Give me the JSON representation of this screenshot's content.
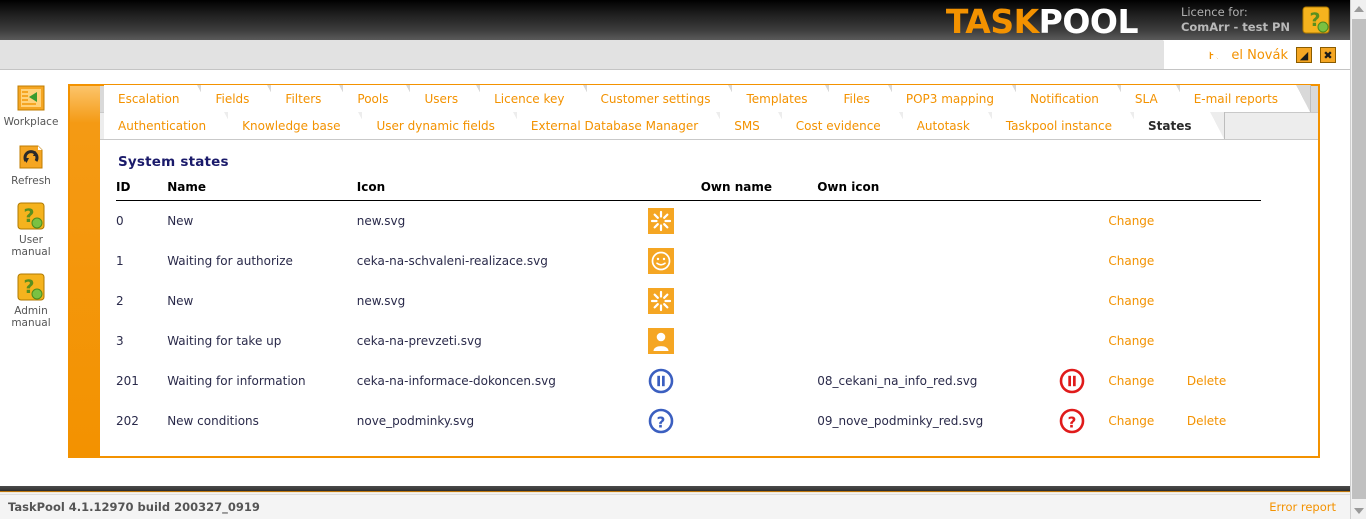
{
  "header": {
    "logo_task": "TASK",
    "logo_pool": "POOL",
    "licence_label": "Licence for:",
    "licence_value": "ComArr - test PN",
    "help_icon": "question-help-icon",
    "accent_color": "#f39200"
  },
  "userbar": {
    "username": "Pavel Novák",
    "logout_icon": "logout-arrow-icon",
    "close_icon": "close-x-icon",
    "logout_glyph": "◢",
    "close_glyph": "✖"
  },
  "sidebar": {
    "items": [
      {
        "label": "Workplace",
        "icon": "workplace-icon"
      },
      {
        "label": "Refresh",
        "icon": "refresh-icon"
      },
      {
        "label": "User\nmanual",
        "label_line1": "User",
        "label_line2": "manual",
        "icon": "user-manual-icon"
      },
      {
        "label": "Admin\nmanual",
        "label_line1": "Admin",
        "label_line2": "manual",
        "icon": "admin-manual-icon"
      }
    ]
  },
  "tabs_row1": [
    {
      "label": "Escalation",
      "active": false
    },
    {
      "label": "Fields",
      "active": false
    },
    {
      "label": "Filters",
      "active": false
    },
    {
      "label": "Pools",
      "active": false
    },
    {
      "label": "Users",
      "active": false
    },
    {
      "label": "Licence key",
      "active": false
    },
    {
      "label": "Customer settings",
      "active": false
    },
    {
      "label": "Templates",
      "active": false
    },
    {
      "label": "Files",
      "active": false
    },
    {
      "label": "POP3 mapping",
      "active": false
    },
    {
      "label": "Notification",
      "active": false
    },
    {
      "label": "SLA",
      "active": false
    },
    {
      "label": "E-mail reports",
      "active": false
    }
  ],
  "tabs_row2": [
    {
      "label": "Authentication",
      "active": false
    },
    {
      "label": "Knowledge base",
      "active": false
    },
    {
      "label": "User dynamic fields",
      "active": false
    },
    {
      "label": "External Database Manager",
      "active": false
    },
    {
      "label": "SMS",
      "active": false
    },
    {
      "label": "Cost evidence",
      "active": false
    },
    {
      "label": "Autotask",
      "active": false
    },
    {
      "label": "Taskpool instance",
      "active": false
    },
    {
      "label": "States",
      "active": true
    }
  ],
  "content": {
    "section_title": "System states",
    "columns": {
      "id": "ID",
      "name": "Name",
      "icon": "Icon",
      "own_name": "Own name",
      "own_icon": "Own icon"
    },
    "action_change": "Change",
    "action_delete": "Delete",
    "rows": [
      {
        "id": "0",
        "name": "New",
        "icon": "new.svg",
        "icon_glyph": "starburst-icon",
        "icon_color": "#f5a623",
        "own_name": "",
        "own_icon": "",
        "own_icon_glyph": "",
        "change": "Change",
        "delete": ""
      },
      {
        "id": "1",
        "name": "Waiting for authorize",
        "icon": "ceka-na-schvaleni-realizace.svg",
        "icon_glyph": "smiley-icon",
        "icon_color": "#f5a623",
        "own_name": "",
        "own_icon": "",
        "own_icon_glyph": "",
        "change": "Change",
        "delete": ""
      },
      {
        "id": "2",
        "name": "New",
        "icon": "new.svg",
        "icon_glyph": "starburst-icon",
        "icon_color": "#f5a623",
        "own_name": "",
        "own_icon": "",
        "own_icon_glyph": "",
        "change": "Change",
        "delete": ""
      },
      {
        "id": "3",
        "name": "Waiting for take up",
        "icon": "ceka-na-prevzeti.svg",
        "icon_glyph": "person-icon",
        "icon_color": "#f5a623",
        "own_name": "",
        "own_icon": "",
        "own_icon_glyph": "",
        "change": "Change",
        "delete": ""
      },
      {
        "id": "201",
        "name": "Waiting for information",
        "icon": "ceka-na-informace-dokoncen.svg",
        "icon_glyph": "pause-circle-icon",
        "icon_color": "#3b5fc0",
        "own_name": "",
        "own_icon": "08_cekani_na_info_red.svg",
        "own_icon_glyph": "pause-circle-icon",
        "own_icon_color": "#e01b1b",
        "change": "Change",
        "delete": "Delete"
      },
      {
        "id": "202",
        "name": "New conditions",
        "icon": "nove_podminky.svg",
        "icon_glyph": "question-circle-icon",
        "icon_color": "#3b5fc0",
        "own_name": "",
        "own_icon": "09_nove_podminky_red.svg",
        "own_icon_glyph": "question-circle-icon",
        "own_icon_color": "#e01b1b",
        "change": "Change",
        "delete": "Delete"
      }
    ]
  },
  "footer": {
    "version": "TaskPool 4.1.12970 build 200327_0919",
    "error_report": "Error report"
  }
}
